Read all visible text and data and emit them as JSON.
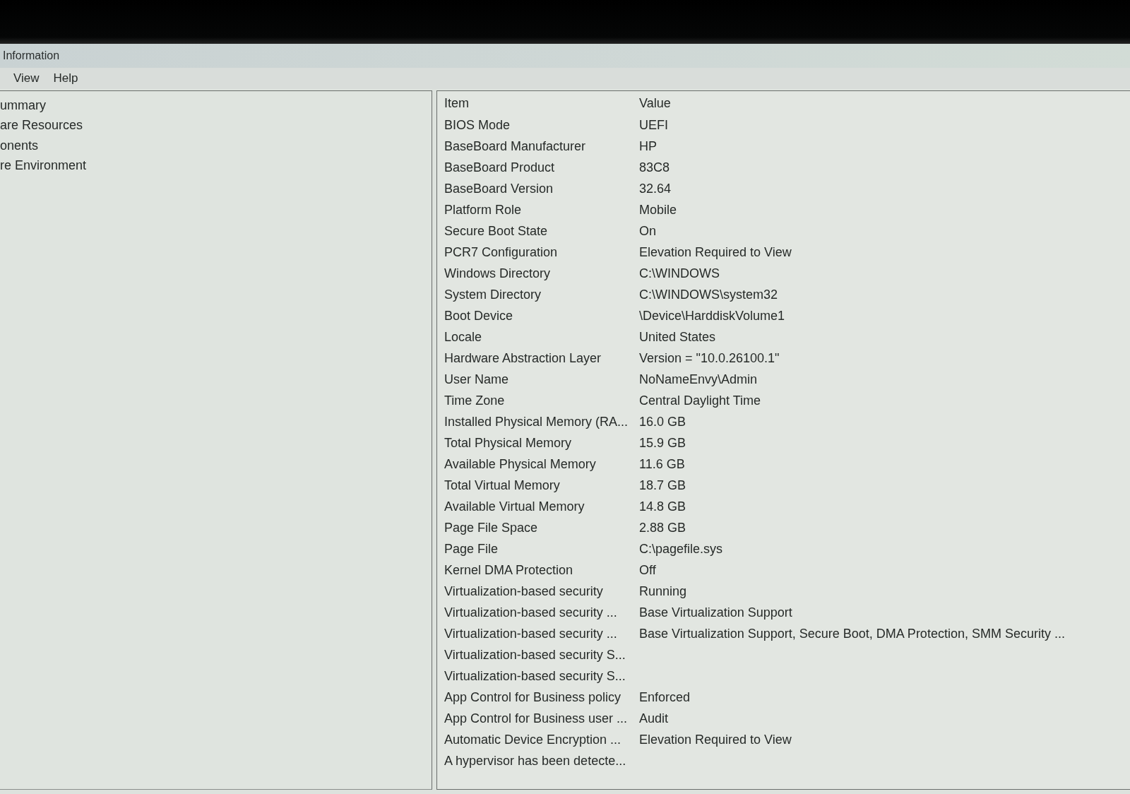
{
  "window": {
    "title": "Information"
  },
  "menu_bar": [
    "View",
    "Help"
  ],
  "tree": {
    "items": [
      "ummary",
      "are Resources",
      "onents",
      "re Environment"
    ]
  },
  "table": {
    "columns": [
      "Item",
      "Value"
    ],
    "rows": [
      {
        "item": "BIOS Mode",
        "value": "UEFI"
      },
      {
        "item": "BaseBoard Manufacturer",
        "value": "HP"
      },
      {
        "item": "BaseBoard Product",
        "value": "83C8"
      },
      {
        "item": "BaseBoard Version",
        "value": "32.64"
      },
      {
        "item": "Platform Role",
        "value": "Mobile"
      },
      {
        "item": "Secure Boot State",
        "value": "On"
      },
      {
        "item": "PCR7 Configuration",
        "value": "Elevation Required to View"
      },
      {
        "item": "Windows Directory",
        "value": "C:\\WINDOWS"
      },
      {
        "item": "System Directory",
        "value": "C:\\WINDOWS\\system32"
      },
      {
        "item": "Boot Device",
        "value": "\\Device\\HarddiskVolume1"
      },
      {
        "item": "Locale",
        "value": "United States"
      },
      {
        "item": "Hardware Abstraction Layer",
        "value": "Version = \"10.0.26100.1\""
      },
      {
        "item": "User Name",
        "value": "NoNameEnvy\\Admin"
      },
      {
        "item": "Time Zone",
        "value": "Central Daylight Time"
      },
      {
        "item": "Installed Physical Memory (RA...",
        "value": "16.0 GB"
      },
      {
        "item": "Total Physical Memory",
        "value": "15.9 GB"
      },
      {
        "item": "Available Physical Memory",
        "value": "11.6 GB"
      },
      {
        "item": "Total Virtual Memory",
        "value": "18.7 GB"
      },
      {
        "item": "Available Virtual Memory",
        "value": "14.8 GB"
      },
      {
        "item": "Page File Space",
        "value": "2.88 GB"
      },
      {
        "item": "Page File",
        "value": "C:\\pagefile.sys"
      },
      {
        "item": "Kernel DMA Protection",
        "value": "Off"
      },
      {
        "item": "Virtualization-based security",
        "value": "Running"
      },
      {
        "item": "Virtualization-based security ...",
        "value": "Base Virtualization Support"
      },
      {
        "item": "Virtualization-based security ...",
        "value": "Base Virtualization Support, Secure Boot, DMA Protection, SMM Security ..."
      },
      {
        "item": "Virtualization-based security S..."
      },
      {
        "item": "Virtualization-based security S..."
      },
      {
        "item": "App Control for Business policy",
        "value": "Enforced"
      },
      {
        "item": "App Control for Business user ...",
        "value": "Audit"
      },
      {
        "item": "Automatic Device Encryption ...",
        "value": "Elevation Required to View"
      },
      {
        "item": "A hypervisor has been detecte..."
      }
    ]
  }
}
